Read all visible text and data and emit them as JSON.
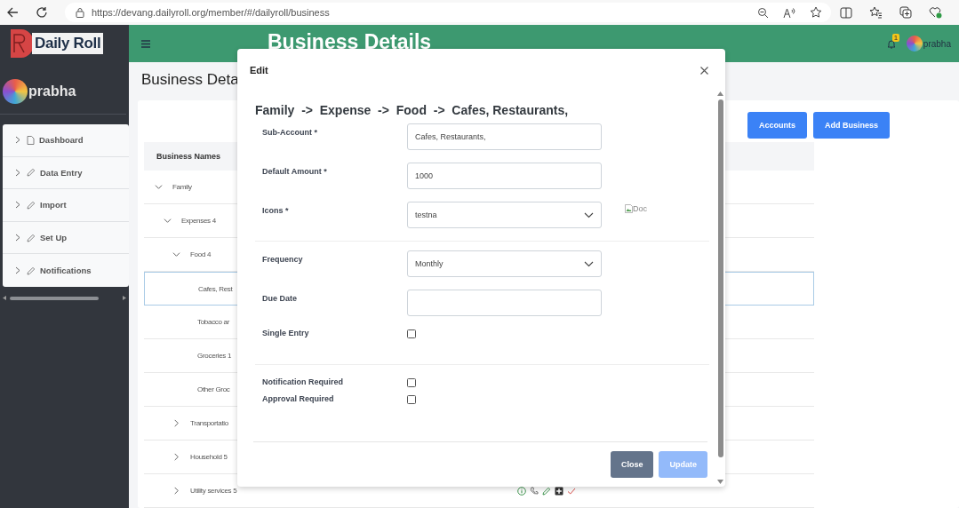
{
  "browser": {
    "url": "https://devang.dailyroll.org/member/#/dailyroll/business"
  },
  "sidebar": {
    "logo": "Daily Roll",
    "user": "prabha",
    "menu": [
      {
        "label": "Dashboard"
      },
      {
        "label": "Data Entry"
      },
      {
        "label": "Import"
      },
      {
        "label": "Set Up"
      },
      {
        "label": "Notifications"
      }
    ]
  },
  "header": {
    "title": "Business Details",
    "notification_count": "1",
    "user": "prabha"
  },
  "page": {
    "title": "Business Deta",
    "buttons": [
      "Accounts",
      "Add Business"
    ],
    "table": {
      "columns": [
        "Business Names"
      ],
      "rows": [
        {
          "name": "Family",
          "expanded": true,
          "selected": false,
          "children": [
            {
              "name": "Expenses 4",
              "expanded": true,
              "selected": false,
              "children": [
                {
                  "name": "Food 4",
                  "expanded": true,
                  "selected": false,
                  "children": [
                    {
                      "name": "Cafes, Rest",
                      "selected": true
                    },
                    {
                      "name": "Tobacco ar",
                      "selected": false
                    },
                    {
                      "name": "Groceries 1",
                      "selected": false
                    },
                    {
                      "name": "Other Groc",
                      "selected": false
                    }
                  ]
                },
                {
                  "name": "Transportatio",
                  "expanded": false,
                  "selected": false
                },
                {
                  "name": "Household 5",
                  "expanded": false,
                  "selected": false
                },
                {
                  "name": "Utility services 5",
                  "expanded": false,
                  "selected": false,
                  "actions": true
                }
              ]
            }
          ]
        }
      ]
    }
  },
  "modal": {
    "title": "Edit",
    "breadcrumb": "Family  ->  Expense  ->  Food  ->  Cafes, Restaurants,",
    "sections": [
      [
        {
          "kind": "text",
          "label": "Sub-Account *",
          "value": "Cafes, Restaurants,"
        },
        {
          "kind": "text",
          "label": "Default Amount *",
          "value": "1000"
        },
        {
          "kind": "select",
          "label": "Icons *",
          "value": "testna",
          "image_alt": "Doc"
        }
      ],
      [
        {
          "kind": "select",
          "label": "Frequency",
          "value": "Monthly"
        },
        {
          "kind": "text",
          "label": "Due Date"
        },
        {
          "kind": "checkbox",
          "label": "Single Entry",
          "checked": false
        }
      ],
      [
        {
          "kind": "checkbox",
          "label": "Notification Required",
          "checked": false
        },
        {
          "kind": "checkbox",
          "label": "Approval Required",
          "checked": false
        }
      ]
    ],
    "buttons": [
      {
        "label": "Close",
        "kind": "secondary",
        "disabled": false
      },
      {
        "label": "Update",
        "kind": "primary",
        "disabled": true
      }
    ]
  }
}
